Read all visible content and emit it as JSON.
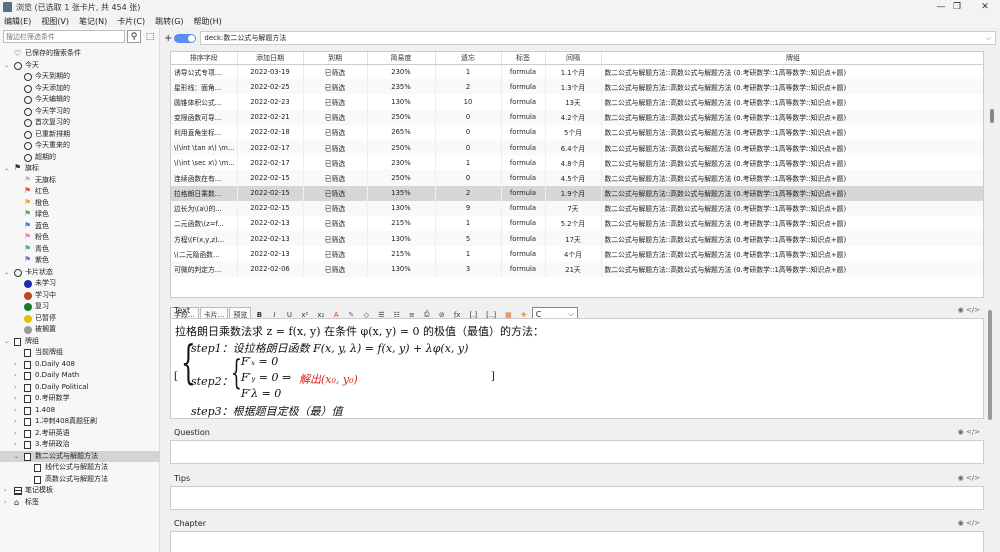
{
  "window": {
    "title": "浏览 (已选取 1 张卡片, 共 454 张)",
    "controls": {
      "minimize": "—",
      "maximize": "❐",
      "close": "✕"
    }
  },
  "menu": [
    "编辑(E)",
    "视图(V)",
    "笔记(N)",
    "卡片(C)",
    "跳转(G)",
    "帮助(H)"
  ],
  "sidebar": {
    "search_placeholder": "搜边栏筛选条件",
    "items": [
      {
        "label": "已保存的搜索条件",
        "level": 0,
        "icon": "heart",
        "arrow": ""
      },
      {
        "label": "今天",
        "level": 0,
        "icon": "clock",
        "arrow": "v"
      },
      {
        "label": "今天到期的",
        "level": 1,
        "icon": "clock",
        "arrow": ""
      },
      {
        "label": "今天添加的",
        "level": 1,
        "icon": "clock",
        "arrow": ""
      },
      {
        "label": "今天编辑的",
        "level": 1,
        "icon": "clock",
        "arrow": ""
      },
      {
        "label": "今天学习的",
        "level": 1,
        "icon": "clock",
        "arrow": ""
      },
      {
        "label": "首次复习的",
        "level": 1,
        "icon": "clock",
        "arrow": ""
      },
      {
        "label": "已重新排期",
        "level": 1,
        "icon": "clock",
        "arrow": ""
      },
      {
        "label": "今天重来的",
        "level": 1,
        "icon": "clock",
        "arrow": ""
      },
      {
        "label": "超期的",
        "level": 1,
        "icon": "clock",
        "arrow": ""
      },
      {
        "label": "旗标",
        "level": 0,
        "icon": "flag",
        "arrow": "v",
        "color": "#333"
      },
      {
        "label": "无旗标",
        "level": 1,
        "icon": "flag",
        "arrow": "",
        "color": "#bbb"
      },
      {
        "label": "红色",
        "level": 1,
        "icon": "flag",
        "arrow": "",
        "color": "#e84c4c"
      },
      {
        "label": "橙色",
        "level": 1,
        "icon": "flag",
        "arrow": "",
        "color": "#f0a030"
      },
      {
        "label": "绿色",
        "level": 1,
        "icon": "flag",
        "arrow": "",
        "color": "#4caf50"
      },
      {
        "label": "蓝色",
        "level": 1,
        "icon": "flag",
        "arrow": "",
        "color": "#3d7fe0"
      },
      {
        "label": "粉色",
        "level": 1,
        "icon": "flag",
        "arrow": "",
        "color": "#f07ad0"
      },
      {
        "label": "青色",
        "level": 1,
        "icon": "flag",
        "arrow": "",
        "color": "#30b8b0"
      },
      {
        "label": "紫色",
        "level": 1,
        "icon": "flag",
        "arrow": "",
        "color": "#9a5cd0"
      },
      {
        "label": "卡片状态",
        "level": 0,
        "icon": "circle",
        "arrow": "v"
      },
      {
        "label": "未学习",
        "level": 1,
        "icon": "dot",
        "arrow": "",
        "color": "#1a2ea8"
      },
      {
        "label": "学习中",
        "level": 1,
        "icon": "dot",
        "arrow": "",
        "color": "#b84a1a"
      },
      {
        "label": "复习",
        "level": 1,
        "icon": "dot",
        "arrow": "",
        "color": "#1a7a2a"
      },
      {
        "label": "已暂停",
        "level": 1,
        "icon": "dot",
        "arrow": "",
        "color": "#e0c000"
      },
      {
        "label": "被搁置",
        "level": 1,
        "icon": "dot",
        "arrow": "",
        "color": "#999999"
      },
      {
        "label": "牌组",
        "level": 0,
        "icon": "deck",
        "arrow": "v"
      },
      {
        "label": "当前牌组",
        "level": 1,
        "icon": "deck",
        "arrow": ""
      },
      {
        "label": "0.Daily 408",
        "level": 1,
        "icon": "deck",
        "arrow": ">"
      },
      {
        "label": "0.Daily Math",
        "level": 1,
        "icon": "deck",
        "arrow": ">"
      },
      {
        "label": "0.Daily Political",
        "level": 1,
        "icon": "deck",
        "arrow": ">"
      },
      {
        "label": "0.考研数学",
        "level": 1,
        "icon": "deck",
        "arrow": ">"
      },
      {
        "label": "1.408",
        "level": 1,
        "icon": "deck",
        "arrow": ">"
      },
      {
        "label": "1.冲刺408真题狂刷",
        "level": 1,
        "icon": "deck",
        "arrow": ">"
      },
      {
        "label": "2.考研英语",
        "level": 1,
        "icon": "deck",
        "arrow": ">"
      },
      {
        "label": "3.考研政治",
        "level": 1,
        "icon": "deck",
        "arrow": ">"
      },
      {
        "label": "数二公式与解题方法",
        "level": 1,
        "icon": "deck",
        "arrow": "v",
        "selected": true
      },
      {
        "label": "线代公式与解题方法",
        "level": 2,
        "icon": "deck2",
        "arrow": ""
      },
      {
        "label": "高数公式与解题方法",
        "level": 2,
        "icon": "deck2",
        "arrow": ""
      },
      {
        "label": "笔记模板",
        "level": 0,
        "icon": "table",
        "arrow": ">"
      },
      {
        "label": "标签",
        "level": 0,
        "icon": "tag",
        "arrow": ">"
      }
    ]
  },
  "search": {
    "query": "deck:数二公式与解题方法"
  },
  "table": {
    "headers": [
      "排序字段",
      "添加日期",
      "到期",
      "简易度",
      "遗忘",
      "标签",
      "间隔",
      "牌组"
    ],
    "rows": [
      [
        "诱导公式专项...",
        "2022-03-19",
        "已筛选",
        "230%",
        "1",
        "formula",
        "1.1个月",
        "数二公式与解题方法::高数公式与解题方法 (0.考研数学::1高等数学::知识点+题)"
      ],
      [
        "星形线：面角...",
        "2022-02-25",
        "已筛选",
        "235%",
        "2",
        "formula",
        "1.3个月",
        "数二公式与解题方法::高数公式与解题方法 (0.考研数学::1高等数学::知识点+题)"
      ],
      [
        "圆锥体积公式...",
        "2022-02-23",
        "已筛选",
        "130%",
        "10",
        "formula",
        "13天",
        "数二公式与解题方法::高数公式与解题方法 (0.考研数学::1高等数学::知识点+题)"
      ],
      [
        "变限函数可导...",
        "2022-02-21",
        "已筛选",
        "250%",
        "0",
        "formula",
        "4.2个月",
        "数二公式与解题方法::高数公式与解题方法 (0.考研数学::1高等数学::知识点+题)"
      ],
      [
        "利用直角坐标...",
        "2022-02-18",
        "已筛选",
        "265%",
        "0",
        "formula",
        "5个月",
        "数二公式与解题方法::高数公式与解题方法 (0.考研数学::1高等数学::知识点+题)"
      ],
      [
        "\\(\\int \\tan x\\) \\m...",
        "2022-02-17",
        "已筛选",
        "250%",
        "0",
        "formula",
        "6.4个月",
        "数二公式与解题方法::高数公式与解题方法 (0.考研数学::1高等数学::知识点+题)"
      ],
      [
        "\\(\\int \\sec x\\) \\m...",
        "2022-02-17",
        "已筛选",
        "230%",
        "1",
        "formula",
        "4.8个月",
        "数二公式与解题方法::高数公式与解题方法 (0.考研数学::1高等数学::知识点+题)"
      ],
      [
        "连续函数在有...",
        "2022-02-15",
        "已筛选",
        "250%",
        "0",
        "formula",
        "4.5个月",
        "数二公式与解题方法::高数公式与解题方法 (0.考研数学::1高等数学::知识点+题)"
      ],
      [
        "拉格朗日乘数...",
        "2022-02-15",
        "已筛选",
        "135%",
        "2",
        "formula",
        "1.9个月",
        "数二公式与解题方法::高数公式与解题方法 (0.考研数学::1高等数学::知识点+题)"
      ],
      [
        "边长为\\(a\\)的...",
        "2022-02-15",
        "已筛选",
        "130%",
        "9",
        "formula",
        "7天",
        "数二公式与解题方法::高数公式与解题方法 (0.考研数学::1高等数学::知识点+题)"
      ],
      [
        "二元函数\\(z=f...",
        "2022-02-13",
        "已筛选",
        "215%",
        "1",
        "formula",
        "5.2个月",
        "数二公式与解题方法::高数公式与解题方法 (0.考研数学::1高等数学::知识点+题)"
      ],
      [
        "方程\\(F(x,y,z)...",
        "2022-02-13",
        "已筛选",
        "130%",
        "5",
        "formula",
        "17天",
        "数二公式与解题方法::高数公式与解题方法 (0.考研数学::1高等数学::知识点+题)"
      ],
      [
        "\\(二元隐函数...",
        "2022-02-13",
        "已筛选",
        "215%",
        "1",
        "formula",
        "4个月",
        "数二公式与解题方法::高数公式与解题方法 (0.考研数学::1高等数学::知识点+题)"
      ],
      [
        "可微的判定方...",
        "2022-02-06",
        "已筛选",
        "130%",
        "3",
        "formula",
        "21天",
        "数二公式与解题方法::高数公式与解题方法 (0.考研数学::1高等数学::知识点+题)"
      ]
    ],
    "selected_index": 8
  },
  "toolbar": {
    "buttons": [
      "字段...",
      "卡片...",
      "预览",
      "B",
      "I",
      "U",
      "x²",
      "x₂",
      "A",
      "✎",
      "◇",
      "☰",
      "☷",
      "≡",
      "⎙",
      "⊘",
      "ƒx",
      "[.]",
      "[..]",
      "▦",
      "✚"
    ],
    "color_value": "C"
  },
  "fields": {
    "text_label": "Text",
    "question_label": "Question",
    "tips_label": "Tips",
    "chapter_label": "Chapter",
    "field_icons": "◉ </>",
    "math": {
      "line1": "拉格朗日乘数法求 z = f(x, y) 在条件 φ(x, y) = 0 的极值（最值）的方法：",
      "step1": "step1：设拉格朗日函数 F(x, y, λ) = f(x, y) + λφ(x, y)",
      "step2": "step2：",
      "fx": "F′ₓ = 0",
      "fy": "F′ᵧ = 0 ⇒",
      "solve": "解出(x₀, y₀)",
      "fl": "F′λ = 0",
      "step3": "step3：根据题目定极（最）值"
    }
  }
}
